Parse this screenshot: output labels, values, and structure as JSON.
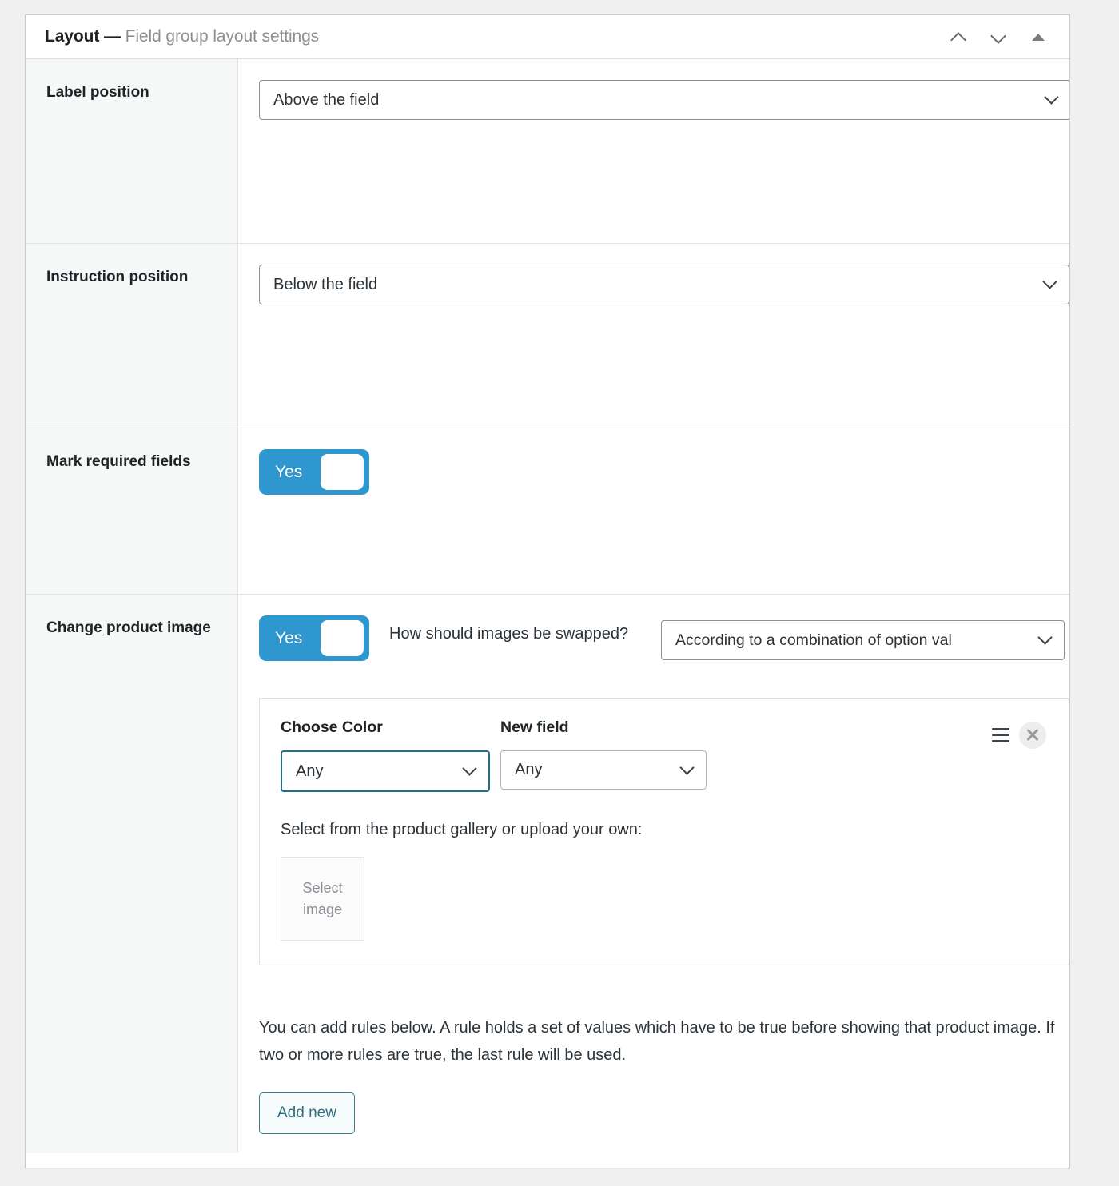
{
  "panel": {
    "title": "Layout",
    "separator": " — ",
    "subtitle": "Field group layout settings",
    "header_actions": [
      {
        "name": "move-up",
        "icon": "chevron-up-icon"
      },
      {
        "name": "move-down",
        "icon": "chevron-down-icon"
      },
      {
        "name": "collapse",
        "icon": "triangle-up-icon"
      }
    ]
  },
  "rows": {
    "label_position": {
      "label": "Label position",
      "select_value": "Above the field"
    },
    "instruction_position": {
      "label": "Instruction position",
      "select_value": "Below the field"
    },
    "mark_required_fields": {
      "label": "Mark required fields",
      "toggle_label": "Yes",
      "toggle_state": "on"
    },
    "change_product_image": {
      "label": "Change product image",
      "toggle_label": "Yes",
      "toggle_state": "on",
      "swap_question": "How should images be swapped?",
      "swap_select_value": "According to a combination of option val",
      "rule_card": {
        "col1_title": "Choose Color",
        "col1_value": "Any",
        "col2_title": "New field",
        "col2_value": "Any",
        "gallery_hint": "Select from the product gallery or upload your own:",
        "select_image_line1": "Select",
        "select_image_line2": "image",
        "drag_icon": "drag-handle-icon",
        "close_icon": "close-icon"
      },
      "rules_description": "You can add rules below. A rule holds a set of values which have to be true before showing that product image. If two or more rules are true, the last rule will be used.",
      "add_new_label": "Add new"
    }
  },
  "colors": {
    "toggle_on": "#2e97cf",
    "accent_link": "#2e6e80",
    "focus_border": "#1f6f8b",
    "panel_bg": "#ffffff",
    "label_col_bg": "#f6f7f7",
    "page_bg": "#f0f0f1"
  }
}
